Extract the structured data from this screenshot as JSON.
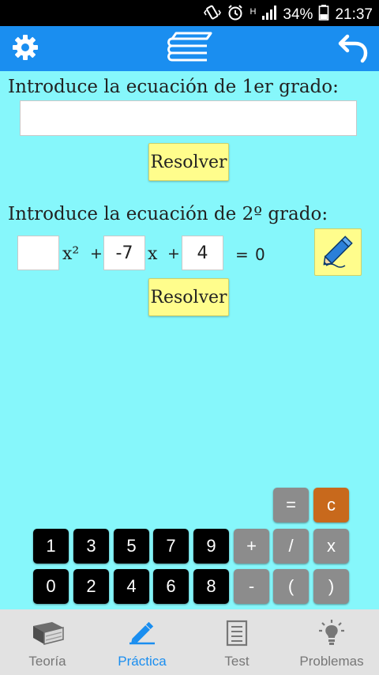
{
  "status_bar": {
    "network": "H",
    "battery": "34%",
    "time": "21:37"
  },
  "toolbar": {
    "settings_icon": "gear-icon",
    "book_icon": "books-icon",
    "back_icon": "undo-arrow-icon"
  },
  "linear": {
    "label": "Introduce la ecuación de 1er grado:",
    "input_value": "",
    "solve_label": "Resolver"
  },
  "quadratic": {
    "label": "Introduce la ecuación de 2º grado:",
    "a": "",
    "x2": "x²",
    "plus1": "+",
    "b": "-7",
    "x": "x",
    "plus2": "+",
    "c": "4",
    "equals": "=",
    "rhs": "0",
    "solve_label": "Resolver"
  },
  "keypad": {
    "equals": "=",
    "clear": "c",
    "row1": [
      "1",
      "3",
      "5",
      "7",
      "9",
      "+",
      "/",
      "x"
    ],
    "row2": [
      "0",
      "2",
      "4",
      "6",
      "8",
      "-",
      "(",
      ")"
    ]
  },
  "nav": [
    {
      "label": "Teoría",
      "icon": "book-icon"
    },
    {
      "label": "Práctica",
      "icon": "pencil-icon"
    },
    {
      "label": "Test",
      "icon": "checklist-icon"
    },
    {
      "label": "Problemas",
      "icon": "lightbulb-icon"
    }
  ],
  "colors": {
    "background": "#86f7fb",
    "toolbar": "#1a8ef0",
    "button": "#fffd8c",
    "clear_key": "#c8691c"
  }
}
